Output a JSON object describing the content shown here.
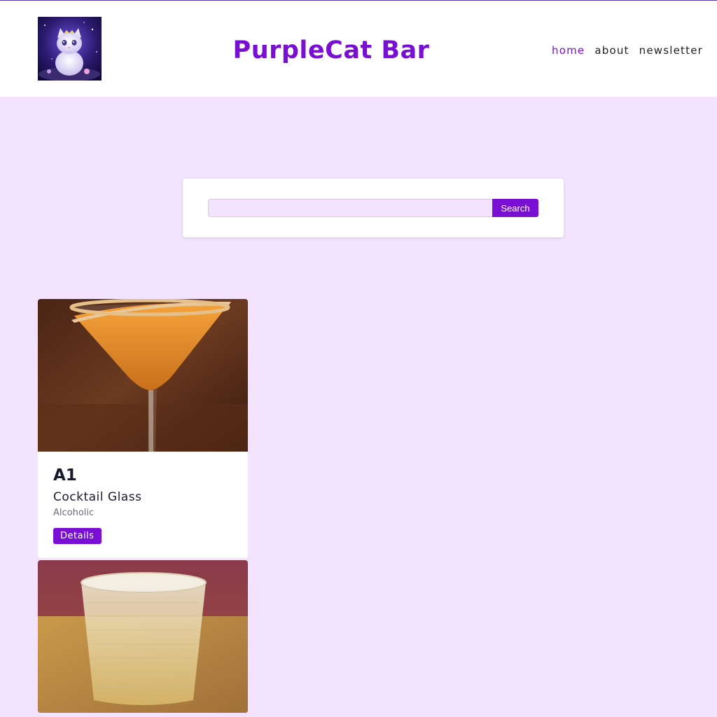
{
  "header": {
    "title": "PurpleCat Bar",
    "nav": [
      {
        "label": "home",
        "active": true
      },
      {
        "label": "about",
        "active": false
      },
      {
        "label": "newsletter",
        "active": false
      }
    ]
  },
  "search": {
    "value": "",
    "button_label": "Search"
  },
  "drinks": [
    {
      "name": "A1",
      "glass": "Cocktail Glass",
      "type": "Alcoholic",
      "button_label": "Details"
    }
  ],
  "colors": {
    "accent": "#7a0fd4",
    "background": "#f3e3fe"
  }
}
